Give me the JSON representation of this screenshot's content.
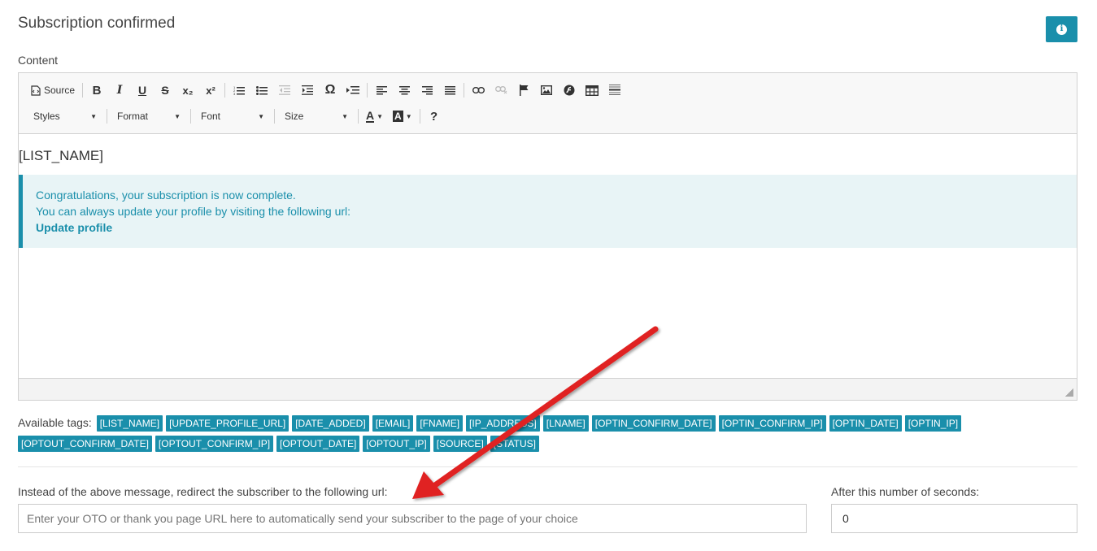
{
  "page": {
    "title": "Subscription confirmed",
    "content_label": "Content"
  },
  "info_button": {
    "icon": "info-icon",
    "glyph": "i"
  },
  "toolbar": {
    "source_label": "Source",
    "bold": "B",
    "italic": "I",
    "underline": "U",
    "strike": "S",
    "subscript": "x₂",
    "superscript": "x²",
    "omega": "Ω",
    "styles_label": "Styles",
    "format_label": "Format",
    "font_label": "Font",
    "size_label": "Size",
    "text_color": "A",
    "bg_color": "A",
    "help": "?"
  },
  "editor": {
    "list_name": "[LIST_NAME]",
    "alert_line1": "Congratulations, your subscription is now complete.",
    "alert_line2": "You can always update your profile by visiting the following url:",
    "alert_link": "Update profile"
  },
  "tags": {
    "label": "Available tags:",
    "items": [
      "[LIST_NAME]",
      "[UPDATE_PROFILE_URL]",
      "[DATE_ADDED]",
      "[EMAIL]",
      "[FNAME]",
      "[IP_ADDRESS]",
      "[LNAME]",
      "[OPTIN_CONFIRM_DATE]",
      "[OPTIN_CONFIRM_IP]",
      "[OPTIN_DATE]",
      "[OPTIN_IP]",
      "[OPTOUT_CONFIRM_DATE]",
      "[OPTOUT_CONFIRM_IP]",
      "[OPTOUT_DATE]",
      "[OPTOUT_IP]",
      "[SOURCE]",
      "[STATUS]"
    ]
  },
  "redirect": {
    "label": "Instead of the above message, redirect the subscriber to the following url:",
    "placeholder": "Enter your OTO or thank you page URL here to automatically send your subscriber to the page of your choice",
    "value": ""
  },
  "seconds": {
    "label": "After this number of seconds:",
    "value": "0"
  },
  "colors": {
    "accent": "#1a8fab",
    "alert_bg": "#e8f4f6",
    "arrow": "#e02020"
  }
}
